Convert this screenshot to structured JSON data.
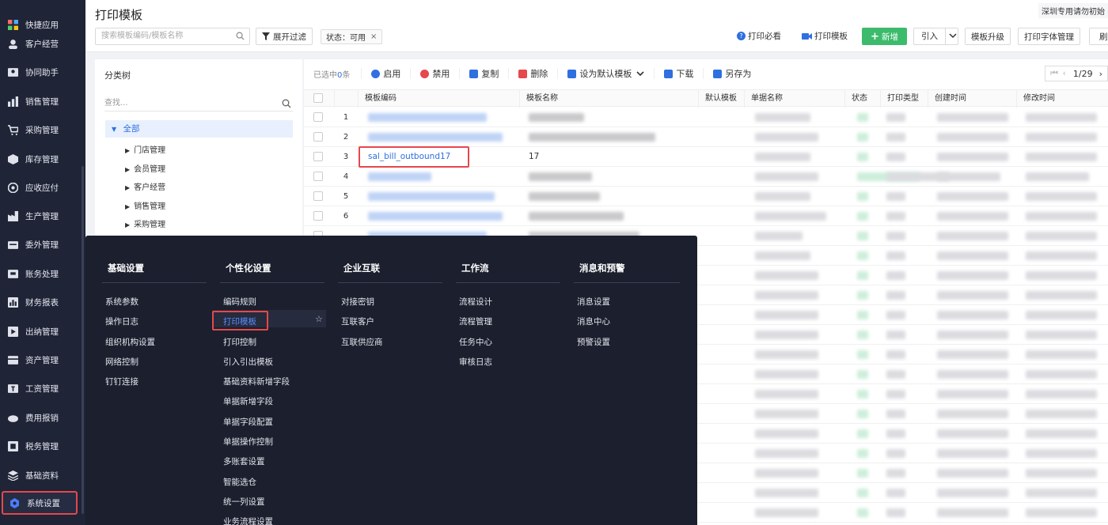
{
  "sidebar": {
    "items": [
      {
        "label": "快捷应用",
        "icon": "apps-icon"
      },
      {
        "label": "客户经营",
        "icon": "customer-icon"
      },
      {
        "label": "协同助手",
        "icon": "assistant-icon"
      },
      {
        "label": "销售管理",
        "icon": "sales-icon"
      },
      {
        "label": "采购管理",
        "icon": "cart-icon"
      },
      {
        "label": "库存管理",
        "icon": "box-icon"
      },
      {
        "label": "应收应付",
        "icon": "money-icon"
      },
      {
        "label": "生产管理",
        "icon": "factory-icon"
      },
      {
        "label": "委外管理",
        "icon": "outsource-icon"
      },
      {
        "label": "账务处理",
        "icon": "ledger-icon"
      },
      {
        "label": "财务报表",
        "icon": "report-icon"
      },
      {
        "label": "出纳管理",
        "icon": "cashier-icon"
      },
      {
        "label": "资产管理",
        "icon": "asset-icon"
      },
      {
        "label": "工资管理",
        "icon": "salary-icon"
      },
      {
        "label": "费用报销",
        "icon": "expense-icon"
      },
      {
        "label": "税务管理",
        "icon": "tax-icon"
      },
      {
        "label": "基础资料",
        "icon": "layers-icon"
      },
      {
        "label": "系统设置",
        "icon": "gear-icon"
      }
    ]
  },
  "header": {
    "title": "打印模板",
    "corner_note": "深圳专用请勿初始",
    "search_placeholder": "搜索模板编码/模板名称",
    "filter_label": "展开过滤",
    "status_chip": "状态：可用",
    "print_guide": "打印必看",
    "print_template_video": "打印模板",
    "new_label": "新增",
    "import_label": "引入",
    "upgrade_label": "模板升级",
    "font_manage": "打印字体管理",
    "refresh_label": "刷"
  },
  "tree": {
    "title": "分类树",
    "search_placeholder": "查找...",
    "root": "全部",
    "nodes": [
      "门店管理",
      "会员管理",
      "客户经营",
      "销售管理",
      "采购管理"
    ]
  },
  "toolbar": {
    "selected_prefix": "已选中",
    "selected_count": "0",
    "selected_suffix": "条",
    "enable": "启用",
    "disable": "禁用",
    "copy": "复制",
    "delete": "删除",
    "set_default": "设为默认模板",
    "download": "下载",
    "save_as": "另存为",
    "page": "1/29"
  },
  "table": {
    "headers": [
      "模板编码",
      "模板名称",
      "默认模板",
      "单据名称",
      "状态",
      "打印类型",
      "创建时间",
      "修改时间"
    ],
    "row_numbers": [
      "1",
      "2",
      "3",
      "4",
      "5",
      "6"
    ],
    "highlight_row": {
      "code": "sal_bill_outbound17",
      "name": "17"
    }
  },
  "popup": {
    "columns": [
      {
        "title": "基础设置",
        "items": [
          "系统参数",
          "操作日志",
          "组织机构设置",
          "网络控制",
          "钉钉连接"
        ]
      },
      {
        "title": "个性化设置",
        "items": [
          "编码规则",
          "打印模板",
          "打印控制",
          "引入引出模板",
          "基础资料新增字段",
          "单据新增字段",
          "单据字段配置",
          "单据操作控制",
          "多账套设置",
          "智能选仓",
          "统一列设置",
          "业务流程设置"
        ]
      },
      {
        "title": "企业互联",
        "items": [
          "对接密钥",
          "互联客户",
          "互联供应商"
        ]
      },
      {
        "title": "工作流",
        "items": [
          "流程设计",
          "流程管理",
          "任务中心",
          "审核日志"
        ]
      },
      {
        "title": "消息和预警",
        "items": [
          "消息设置",
          "消息中心",
          "预警设置"
        ]
      }
    ]
  }
}
